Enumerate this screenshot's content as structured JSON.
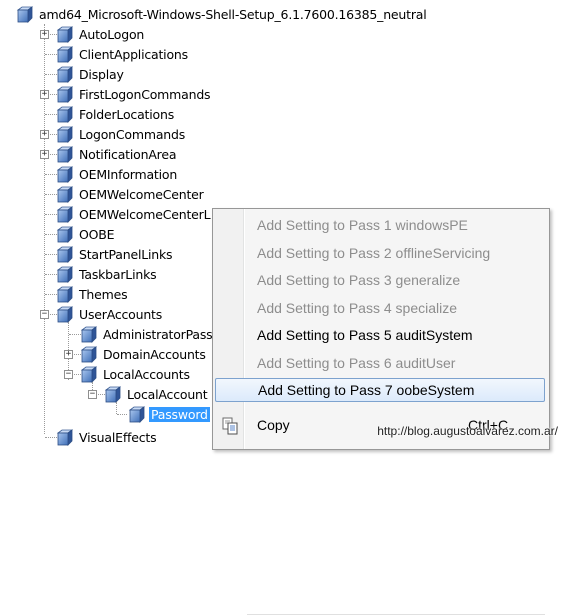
{
  "tree": {
    "root": "amd64_Microsoft-Windows-Shell-Setup_6.1.7600.16385_neutral",
    "items": [
      "AutoLogon",
      "ClientApplications",
      "Display",
      "FirstLogonCommands",
      "FolderLocations",
      "LogonCommands",
      "NotificationArea",
      "OEMInformation",
      "OEMWelcomeCenter",
      "OEMWelcomeCenterL",
      "OOBE",
      "StartPanelLinks",
      "TaskbarLinks",
      "Themes",
      "UserAccounts"
    ],
    "user_accounts_children": [
      "AdministratorPass",
      "DomainAccounts",
      "LocalAccounts"
    ],
    "local_accounts_child": "LocalAccount",
    "selected_leaf": "Password",
    "after": "VisualEffects",
    "expander_plus": "+",
    "expander_minus": "−"
  },
  "context_menu": {
    "items": [
      {
        "label": "Add Setting to Pass 1 windowsPE",
        "enabled": false
      },
      {
        "label": "Add Setting to Pass 2 offlineServicing",
        "enabled": false
      },
      {
        "label": "Add Setting to Pass 3 generalize",
        "enabled": false
      },
      {
        "label": "Add Setting to Pass 4 specialize",
        "enabled": false
      },
      {
        "label": "Add Setting to Pass 5 auditSystem",
        "enabled": true
      },
      {
        "label": "Add Setting to Pass 6 auditUser",
        "enabled": false
      },
      {
        "label": "Add Setting to Pass 7 oobeSystem",
        "enabled": true,
        "highlighted": true
      }
    ],
    "copy_label": "Copy",
    "copy_shortcut": "Ctrl+C"
  },
  "watermark": "http://blog.augustoalvarez.com.ar/",
  "colors": {
    "selection": "#3399ff",
    "menu_hover_border": "#7da2ce",
    "disabled_text": "#8d8d8d",
    "cube_blue": "#5a86c9"
  },
  "icons": [
    "component-cube-icon",
    "copy-icon"
  ]
}
